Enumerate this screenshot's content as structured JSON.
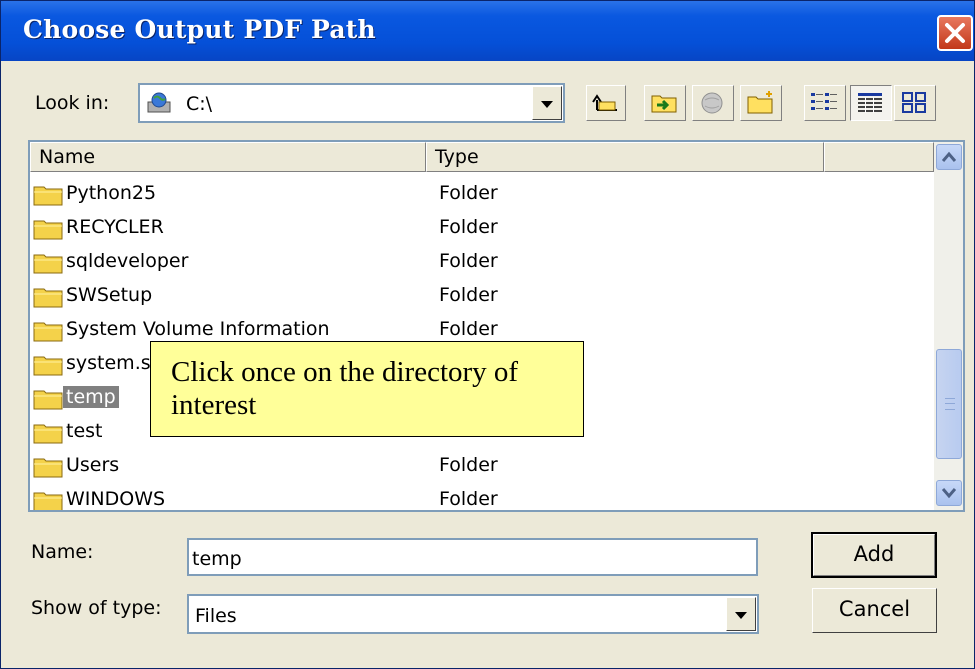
{
  "window": {
    "title": "Choose Output PDF Path"
  },
  "toolbar": {
    "look_in_label": "Look in:",
    "look_in_value": "C:\\"
  },
  "list": {
    "columns": {
      "name": "Name",
      "type": "Type"
    },
    "rows": [
      {
        "name": "Python25",
        "type": "Folder"
      },
      {
        "name": "RECYCLER",
        "type": "Folder"
      },
      {
        "name": "sqldeveloper",
        "type": "Folder"
      },
      {
        "name": "SWSetup",
        "type": "Folder"
      },
      {
        "name": "System Volume Information",
        "type": "Folder"
      },
      {
        "name": "system.s",
        "type": ""
      },
      {
        "name": "temp",
        "type": ""
      },
      {
        "name": "test",
        "type": ""
      },
      {
        "name": "Users",
        "type": "Folder"
      },
      {
        "name": "WINDOWS",
        "type": "Folder"
      }
    ],
    "selected_row": "temp"
  },
  "callout": {
    "text": "Click once on the directory of interest"
  },
  "form": {
    "name_label": "Name:",
    "name_value": "temp",
    "type_label": "Show of type:",
    "type_value": "Files"
  },
  "buttons": {
    "add": "Add",
    "cancel": "Cancel"
  }
}
